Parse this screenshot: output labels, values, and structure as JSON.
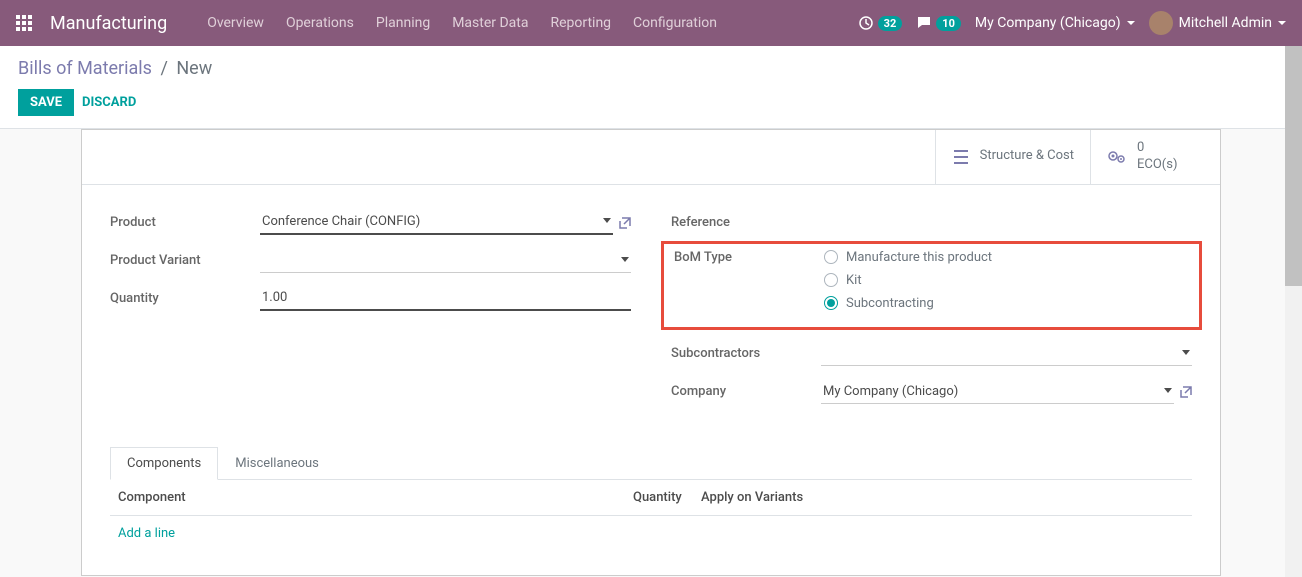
{
  "header": {
    "app_name": "Manufacturing",
    "nav": [
      "Overview",
      "Operations",
      "Planning",
      "Master Data",
      "Reporting",
      "Configuration"
    ],
    "activity_count": "32",
    "msg_count": "10",
    "company": "My Company (Chicago)",
    "user": "Mitchell Admin"
  },
  "breadcrumb": {
    "parent": "Bills of Materials",
    "current": "New"
  },
  "actions": {
    "save": "SAVE",
    "discard": "DISCARD"
  },
  "stat_buttons": {
    "structure": "Structure & Cost",
    "ecos_count": "0",
    "ecos_label": "ECO(s)"
  },
  "fields": {
    "product_label": "Product",
    "product_value": "Conference Chair (CONFIG)",
    "variant_label": "Product Variant",
    "variant_value": "",
    "quantity_label": "Quantity",
    "quantity_value": "1.00",
    "reference_label": "Reference",
    "bom_type_label": "BoM Type",
    "bom_options": {
      "manufacture": "Manufacture this product",
      "kit": "Kit",
      "subcontract": "Subcontracting"
    },
    "subcontractors_label": "Subcontractors",
    "subcontractors_value": "",
    "company_label": "Company",
    "company_value": "My Company (Chicago)"
  },
  "tabs": {
    "components": "Components",
    "misc": "Miscellaneous"
  },
  "table": {
    "col_component": "Component",
    "col_quantity": "Quantity",
    "col_variants": "Apply on Variants",
    "add_line": "Add a line"
  }
}
